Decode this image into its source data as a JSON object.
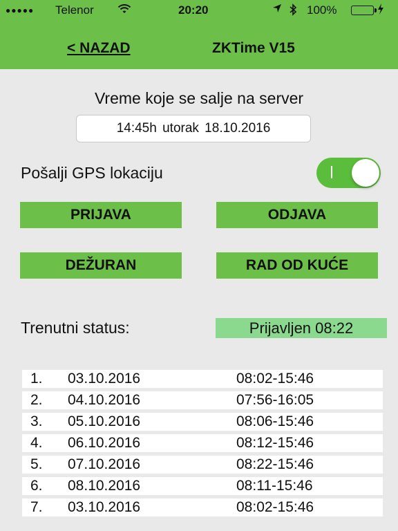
{
  "status_bar": {
    "signal": "●●●●●",
    "carrier": "Telenor",
    "wifi_icon": "wifi-icon",
    "time": "20:20",
    "location_icon": "location-arrow-icon",
    "bluetooth_icon": "bluetooth-icon",
    "battery_percent": "100%"
  },
  "nav": {
    "back_label": "< NAZAD",
    "title": "ZKTime V15"
  },
  "time_section": {
    "caption": "Vreme koje se salje na server",
    "value": "14:45h  utorak  18.10.2016"
  },
  "gps": {
    "label": "Pošalji GPS lokaciju",
    "enabled": true
  },
  "actions": {
    "check_in": "PRIJAVA",
    "check_out": "ODJAVA",
    "on_duty": "DEŽURAN",
    "work_from_home": "RAD OD KUĆE"
  },
  "status": {
    "label": "Trenutni status:",
    "value": "Prijavljen 08:22"
  },
  "log": [
    {
      "index": "1.",
      "date": "03.10.2016",
      "range": "08:02-15:46"
    },
    {
      "index": "2.",
      "date": "04.10.2016",
      "range": "07:56-16:05"
    },
    {
      "index": "3.",
      "date": "05.10.2016",
      "range": "08:06-15:46"
    },
    {
      "index": "4.",
      "date": "06.10.2016",
      "range": "08:12-15:46"
    },
    {
      "index": "5.",
      "date": "07.10.2016",
      "range": "08:22-15:46"
    },
    {
      "index": "6.",
      "date": "08.10.2016",
      "range": "08:11-15:46"
    },
    {
      "index": "7.",
      "date": "03.10.2016",
      "range": "08:02-15:46"
    }
  ],
  "colors": {
    "accent": "#6cc04a",
    "toggle_on": "#5bbd3c",
    "status_badge": "#8bd98f",
    "background": "#e9e9e9"
  }
}
